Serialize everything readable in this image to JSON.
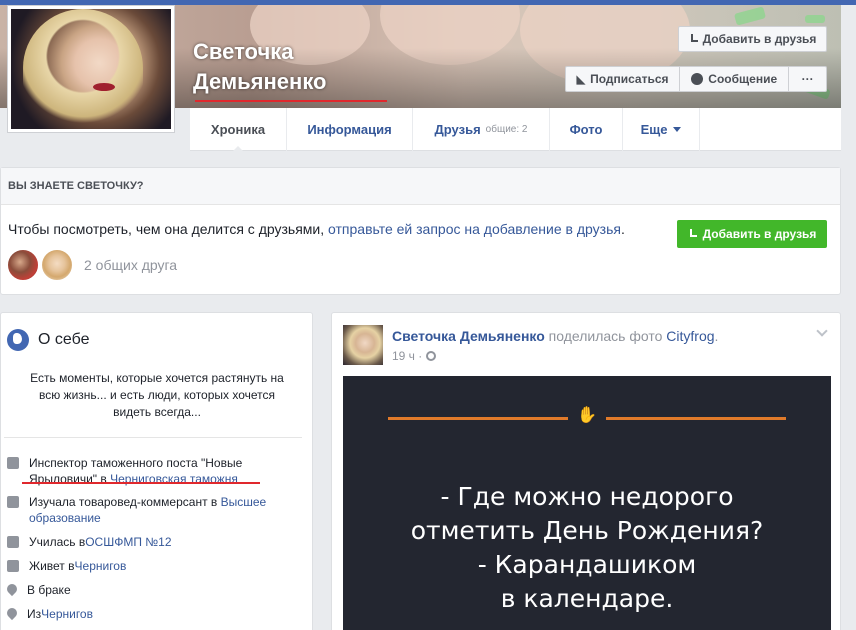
{
  "profile": {
    "name_line1": "Светочка",
    "name_line2": "Демьяненко"
  },
  "header_buttons": {
    "add_friend": "Добавить в друзья",
    "follow": "Подписаться",
    "message": "Сообщение",
    "more": "···"
  },
  "tabs": [
    {
      "label": "Хроника"
    },
    {
      "label": "Информация"
    },
    {
      "label": "Друзья",
      "sub": "общие: 2"
    },
    {
      "label": "Фото"
    },
    {
      "label": "Еще"
    }
  ],
  "know_card": {
    "heading": "ВЫ ЗНАЕТЕ СВЕТОЧКУ?",
    "text_plain": "Чтобы посмотреть, чем она делится с друзьями, ",
    "text_link": "отправьте ей запрос на добавление в друзья",
    "text_end": ".",
    "add_button": "Добавить в друзья",
    "mutual": "2 общих друга"
  },
  "about": {
    "title": "О себе",
    "quote": "Есть моменты, которые хочется растянуть на всю жизнь... и есть люди, которых хочется видеть всегда...",
    "work_text": "Инспектор таможенного поста \"Новые Ярыловичи\" в ",
    "work_link": "Черниговская таможня",
    "study_text": "Изучала товаровед-коммерсант в ",
    "study_link": "Высшее образование",
    "school_text": "Училась в ",
    "school_link": "ОСШФМП №12",
    "lives_text": "Живет в ",
    "lives_link": "Чернигов",
    "relationship": "В браке",
    "from_text": "Из ",
    "from_link": "Чернигов"
  },
  "post": {
    "author": "Светочка Демьяненко",
    "action": " поделилась фото ",
    "page": "Cityfrog",
    "dot": ".",
    "time": "19 ч ·",
    "joke": [
      "- Где можно недорого",
      "отметить День Рождения?",
      "- Карандашиком",
      "в календаре."
    ]
  },
  "colors": {
    "facebook_blue": "#4267b2",
    "link": "#365899",
    "green_button": "#42b72a",
    "annotation_red": "#e0282d",
    "post_accent_orange": "#e07a2a"
  }
}
